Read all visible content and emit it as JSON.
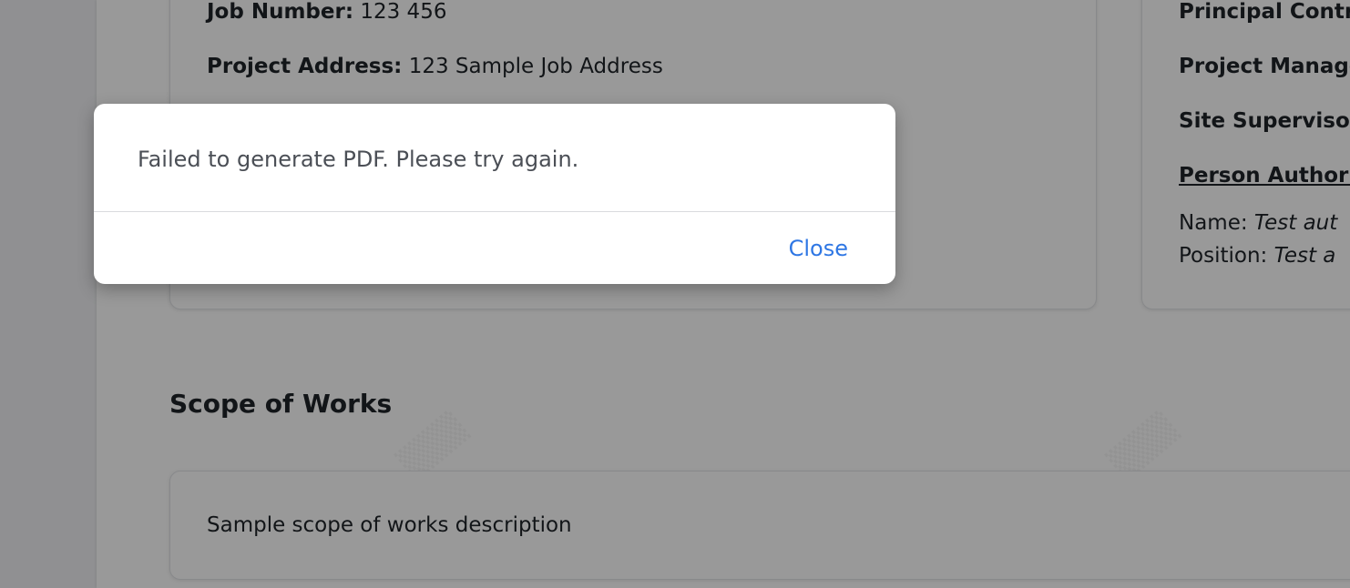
{
  "details": {
    "job_number_label": "Job Number:",
    "job_number_value": "123 456",
    "project_address_label": "Project Address:",
    "project_address_value": "123 Sample Job Address"
  },
  "contacts": {
    "principal_contractor_label": "Principal Contr",
    "project_manager_label": "Project Manage",
    "site_supervisor_label": "Site Supervisor",
    "person_authorised_label": "Person Authori",
    "name_label": "Name:",
    "name_value": "Test aut",
    "position_label": "Position:",
    "position_value": "Test a"
  },
  "scope": {
    "title": "Scope of Works",
    "description": "Sample scope of works description"
  },
  "modal": {
    "message": "Failed to generate PDF. Please try again.",
    "close_label": "Close"
  },
  "colors": {
    "accent": "#2f77e4",
    "overlay": "rgba(0,0,0,0.40)"
  }
}
